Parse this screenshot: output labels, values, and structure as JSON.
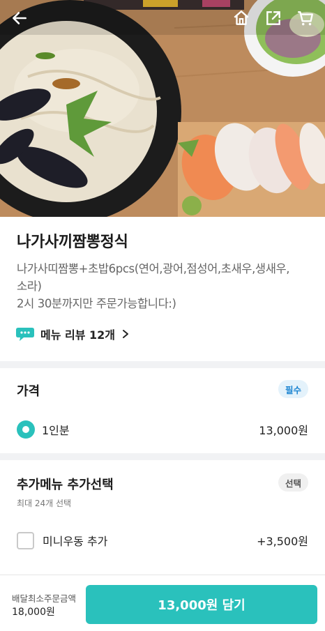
{
  "header": {
    "back_icon": "arrow-left-icon",
    "home_icon": "home-icon",
    "share_icon": "share-icon",
    "cart_icon": "cart-icon"
  },
  "menu": {
    "title": "나가사끼짬뽕정식",
    "description_line1": "나가사띠짬뽕+초밥6pcs(연어,광어,점성어,초새우,생새우,",
    "description_line2": "소라)",
    "description_line3": "2시 30분까지만 주문가능합니다:)",
    "review_link": "메뉴 리뷰 12개"
  },
  "price_section": {
    "title": "가격",
    "badge": "필수",
    "options": [
      {
        "label": "1인분",
        "price": "13,000원",
        "selected": true
      }
    ]
  },
  "extra_section": {
    "title": "추가메뉴 추가선택",
    "badge": "선택",
    "subtitle": "최대 24개 선택",
    "options": [
      {
        "label": "미니우동 추가",
        "price": "+3,500원",
        "checked": false
      }
    ]
  },
  "bottom_bar": {
    "min_order_label": "배달최소주문금액",
    "min_order_value": "18,000원",
    "cart_button": "13,000원 담기"
  },
  "colors": {
    "accent": "#2ac1bc",
    "required_badge_text": "#1b84d1",
    "required_badge_bg": "#e4f2fb"
  }
}
